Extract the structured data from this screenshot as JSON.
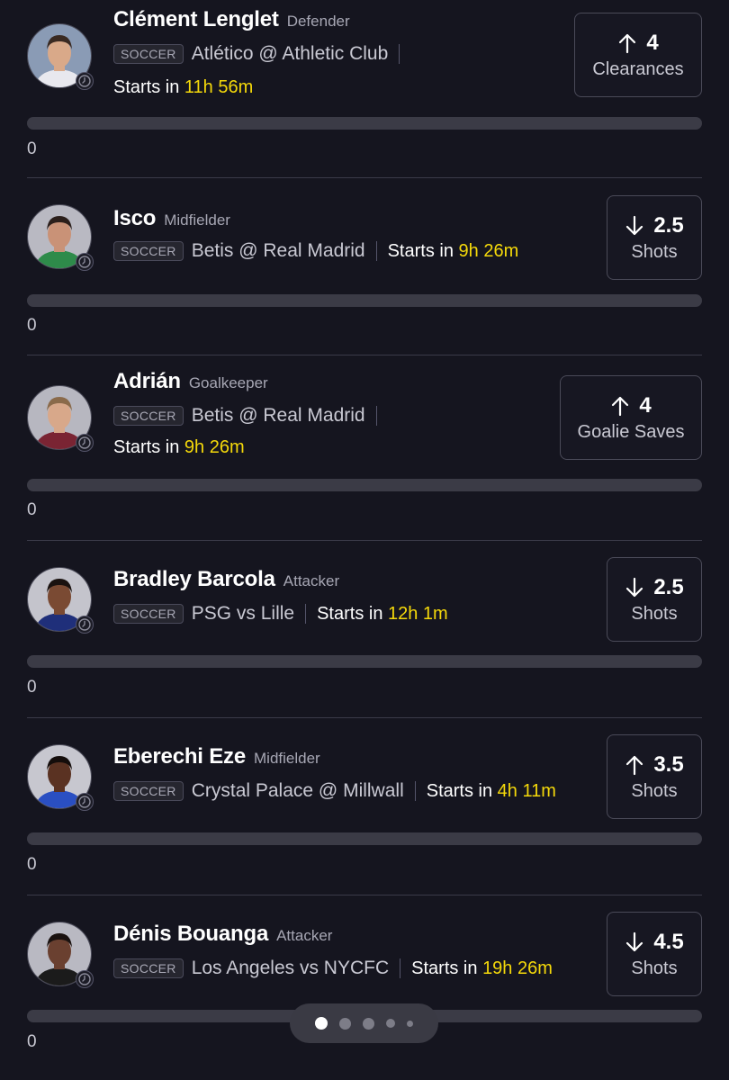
{
  "sport_tag": "SOCCER",
  "starts_prefix": "Starts in",
  "players": [
    {
      "name": "Clément Lenglet",
      "position": "Defender",
      "matchup": "Atlético @ Athletic Club",
      "starts_in": "11h 56m",
      "direction": "up",
      "line": "4",
      "stat": "Clearances",
      "progress": 0,
      "count": "0",
      "avatar_colors": {
        "bg": "#8a9bb5",
        "skin": "#d9a989",
        "hair": "#3a2a22",
        "shirt": "#e8e8ee"
      }
    },
    {
      "name": "Isco",
      "position": "Midfielder",
      "matchup": "Betis @ Real Madrid",
      "starts_in": "9h 26m",
      "direction": "down",
      "line": "2.5",
      "stat": "Shots",
      "progress": 0,
      "count": "0",
      "avatar_colors": {
        "bg": "#b9b9c2",
        "skin": "#c99277",
        "hair": "#2b1f1b",
        "shirt": "#2e8b4a"
      }
    },
    {
      "name": "Adrián",
      "position": "Goalkeeper",
      "matchup": "Betis @ Real Madrid",
      "starts_in": "9h 26m",
      "direction": "up",
      "line": "4",
      "stat": "Goalie Saves",
      "progress": 0,
      "count": "0",
      "avatar_colors": {
        "bg": "#b7b7c0",
        "skin": "#d8a88a",
        "hair": "#8a6a4a",
        "shirt": "#7a2433"
      }
    },
    {
      "name": "Bradley Barcola",
      "position": "Attacker",
      "matchup": "PSG vs Lille",
      "starts_in": "12h 1m",
      "direction": "down",
      "line": "2.5",
      "stat": "Shots",
      "progress": 0,
      "count": "0",
      "avatar_colors": {
        "bg": "#c4c4cc",
        "skin": "#7a4a33",
        "hair": "#1a1210",
        "shirt": "#1f2f7a"
      }
    },
    {
      "name": "Eberechi Eze",
      "position": "Midfielder",
      "matchup": "Crystal Palace @ Millwall",
      "starts_in": "4h 11m",
      "direction": "up",
      "line": "3.5",
      "stat": "Shots",
      "progress": 0,
      "count": "0",
      "avatar_colors": {
        "bg": "#c7c7cf",
        "skin": "#5a3222",
        "hair": "#140d0b",
        "shirt": "#2a4fc2"
      }
    },
    {
      "name": "Dénis Bouanga",
      "position": "Attacker",
      "matchup": "Los Angeles vs NYCFC",
      "starts_in": "19h 26m",
      "direction": "down",
      "line": "4.5",
      "stat": "Shots",
      "progress": 0,
      "count": "0",
      "avatar_colors": {
        "bg": "#b9b9c2",
        "skin": "#6a4030",
        "hair": "#1a1210",
        "shirt": "#1b1b1b"
      }
    }
  ],
  "pager": {
    "page_count": 5,
    "active_index": 0
  }
}
